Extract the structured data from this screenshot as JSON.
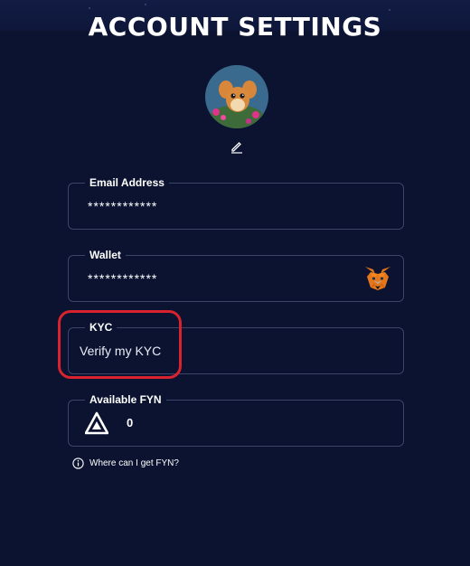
{
  "page": {
    "title": "ACCOUNT SETTINGS"
  },
  "profile": {
    "avatar_icon": "avatar-creature-image",
    "edit_icon": "pencil-icon"
  },
  "fields": {
    "email": {
      "label": "Email Address",
      "value": "************"
    },
    "wallet": {
      "label": "Wallet",
      "value": "************",
      "icon": "metamask-fox-icon"
    },
    "kyc": {
      "label": "KYC",
      "value": "Verify my KYC"
    },
    "fyn": {
      "label": "Available FYN",
      "value": "0",
      "icon": "fyn-token-icon"
    }
  },
  "help": {
    "text": "Where can I get FYN?",
    "icon": "info-icon"
  },
  "colors": {
    "background": "#0b1330",
    "field_border": "#3a4568",
    "highlight": "#d8232e",
    "text": "#ffffff"
  }
}
